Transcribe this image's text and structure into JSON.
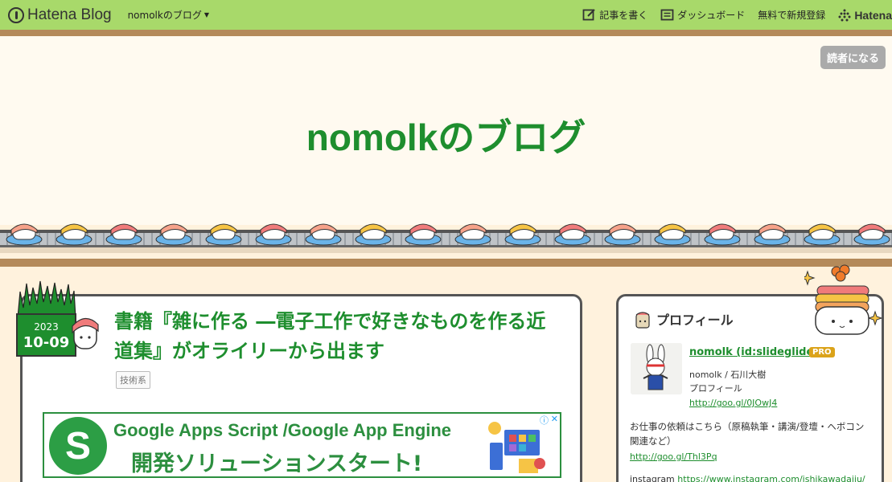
{
  "topbar": {
    "logo_text": "Hatena Blog",
    "blog_menu": "nomolkのブログ",
    "write_label": "記事を書く",
    "dashboard_label": "ダッシュボード",
    "signup_label": "無料で新規登録",
    "hatena_label": "Hatena"
  },
  "header": {
    "subscribe_label": "読者になる",
    "title": "nomolkのブログ"
  },
  "article": {
    "date_year": "2023",
    "date_md": "10-09",
    "title": "書籍『雑に作る ―電子工作で好きなものを作る近道集』がオライリーから出ます",
    "tag": "技術系",
    "ad_line1": "Google Apps Script /Google App Engine",
    "ad_line2": "開発ソリューションスタート!",
    "ad_logo": "S",
    "ad_info": "ⓘ",
    "ad_close": "✕"
  },
  "profile": {
    "heading": "プロフィール",
    "name": "nomolk (id:slideglide)",
    "badge": "PRO",
    "subname": "nomolk / 石川大樹",
    "profile_label": "プロフィール",
    "profile_url": "http://goo.gl/0JOwJ4",
    "request_text": "お仕事の依頼はこちら（原稿執筆・講演/登壇・ヘボコン関連など）",
    "request_url": "http://goo.gl/Thl3Pq",
    "instagram_label": "instagram",
    "instagram_url": "https://www.instagram.com/ishikawadaiju/"
  },
  "colors": {
    "topbar": "#a8d96a",
    "accent_green": "#1e8e2e",
    "brown": "#b48a5a",
    "background": "#fff2dd"
  }
}
